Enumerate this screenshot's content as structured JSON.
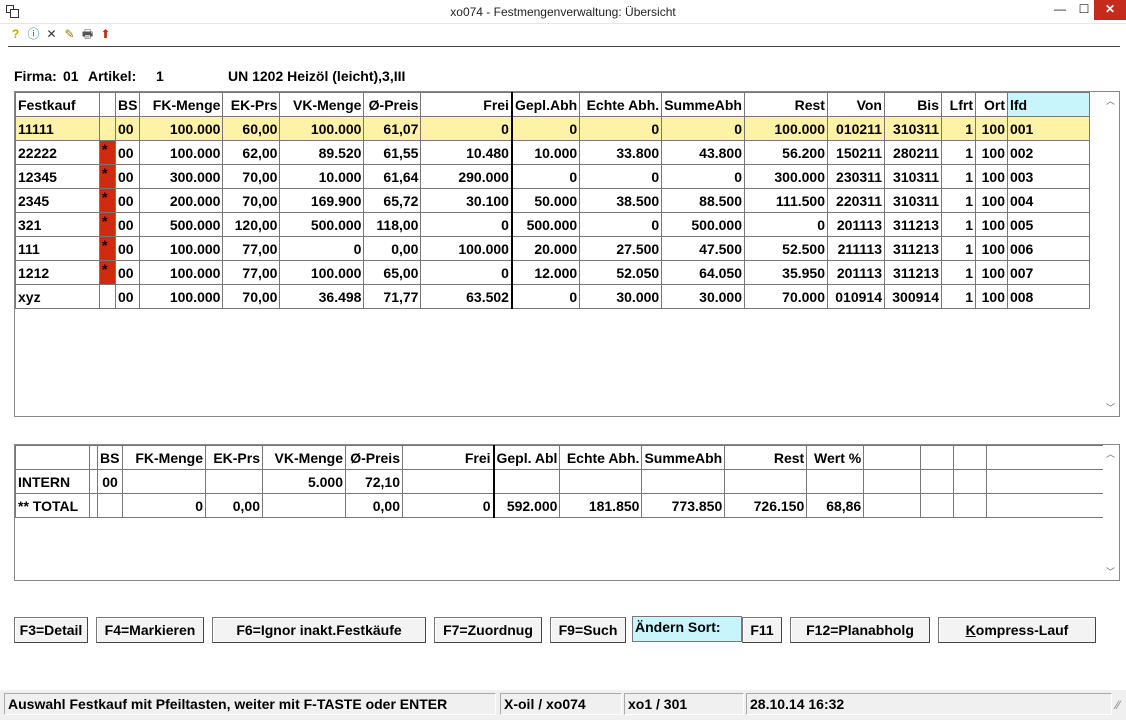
{
  "window": {
    "title": "xo074 - Festmengenverwaltung: Übersicht",
    "min_label": "—",
    "max_label": "☐",
    "close_label": "✕"
  },
  "toolbar": {
    "icons": [
      "help-icon",
      "info-icon",
      "delete-icon",
      "tools-icon",
      "print-icon",
      "export-icon"
    ],
    "glyphs": [
      "?",
      "ⓘ",
      "✕",
      "✎",
      "🖶",
      "⬆"
    ]
  },
  "header": {
    "firma_label": "Firma:",
    "firma_value": "01",
    "artikel_label": "Artikel:",
    "artikel_value": "1",
    "product": "UN 1202 Heizöl (leicht),3,III"
  },
  "main_table": {
    "columns": [
      "Festkauf",
      "",
      "BS",
      "FK-Menge",
      "EK-Prs",
      "VK-Menge",
      "Ø-Preis",
      "Frei",
      "Gepl.Abh",
      "Echte Abh.",
      "SummeAbh",
      "Rest",
      "Von",
      "Bis",
      "Lfrt",
      "Ort",
      "lfd"
    ],
    "rows": [
      [
        "11111",
        "",
        "00",
        "100.000",
        "60,00",
        "100.000",
        "61,07",
        "0",
        "0",
        "0",
        "0",
        "100.000",
        "010211",
        "310311",
        "1",
        "100",
        "001"
      ],
      [
        "22222",
        "*",
        "00",
        "100.000",
        "62,00",
        "89.520",
        "61,55",
        "10.480",
        "10.000",
        "33.800",
        "43.800",
        "56.200",
        "150211",
        "280211",
        "1",
        "100",
        "002"
      ],
      [
        "12345",
        "*",
        "00",
        "300.000",
        "70,00",
        "10.000",
        "61,64",
        "290.000",
        "0",
        "0",
        "0",
        "300.000",
        "230311",
        "310311",
        "1",
        "100",
        "003"
      ],
      [
        "2345",
        "*",
        "00",
        "200.000",
        "70,00",
        "169.900",
        "65,72",
        "30.100",
        "50.000",
        "38.500",
        "88.500",
        "111.500",
        "220311",
        "310311",
        "1",
        "100",
        "004"
      ],
      [
        "321",
        "*",
        "00",
        "500.000",
        "120,00",
        "500.000",
        "118,00",
        "0",
        "500.000",
        "0",
        "500.000",
        "0",
        "201113",
        "311213",
        "1",
        "100",
        "005"
      ],
      [
        "111",
        "*",
        "00",
        "100.000",
        "77,00",
        "0",
        "0,00",
        "100.000",
        "20.000",
        "27.500",
        "47.500",
        "52.500",
        "211113",
        "311213",
        "1",
        "100",
        "006"
      ],
      [
        "1212",
        "*",
        "00",
        "100.000",
        "77,00",
        "100.000",
        "65,00",
        "0",
        "12.000",
        "52.050",
        "64.050",
        "35.950",
        "201113",
        "311213",
        "1",
        "100",
        "007"
      ],
      [
        "xyz",
        "",
        "00",
        "100.000",
        "70,00",
        "36.498",
        "71,77",
        "63.502",
        "0",
        "30.000",
        "30.000",
        "70.000",
        "010914",
        "300914",
        "1",
        "100",
        "008"
      ]
    ]
  },
  "summary_table": {
    "columns": [
      "",
      "",
      "BS",
      "FK-Menge",
      "EK-Prs",
      "VK-Menge",
      "Ø-Preis",
      "Frei",
      "Gepl. Abl",
      "Echte Abh.",
      "SummeAbh",
      "Rest",
      "Wert %",
      "",
      "",
      "",
      ""
    ],
    "rows": [
      [
        "INTERN",
        "",
        "00",
        "",
        "",
        "5.000",
        "72,10",
        "",
        "",
        "",
        "",
        "",
        "",
        "",
        "",
        "",
        ""
      ],
      [
        "** TOTAL",
        "",
        "",
        "0",
        "0,00",
        "",
        "0,00",
        "0",
        "592.000",
        "181.850",
        "773.850",
        "726.150",
        "68,86",
        "",
        "",
        "",
        ""
      ]
    ]
  },
  "buttons": {
    "f3": "F3=Detail",
    "f4": "F4=Markieren",
    "f6": "F6=Ignor inakt.Festkäufe",
    "f7": "F7=Zuordnug",
    "f9": "F9=Such",
    "sort_label": "Ändern Sort:",
    "f11": "F11",
    "f12": "F12=Planabholg",
    "kompress": "Kompress-Lauf"
  },
  "statusbar": {
    "message": "Auswahl Festkauf mit Pfeiltasten, weiter mit F-TASTE oder ENTER",
    "program": "X-oil / xo074",
    "user": "xo1 / 301",
    "datetime": "28.10.14 16:32"
  },
  "colors": {
    "selected_row": "#fdf2a6",
    "marker": "#d22a10",
    "highlight": "#c8f4fb"
  }
}
